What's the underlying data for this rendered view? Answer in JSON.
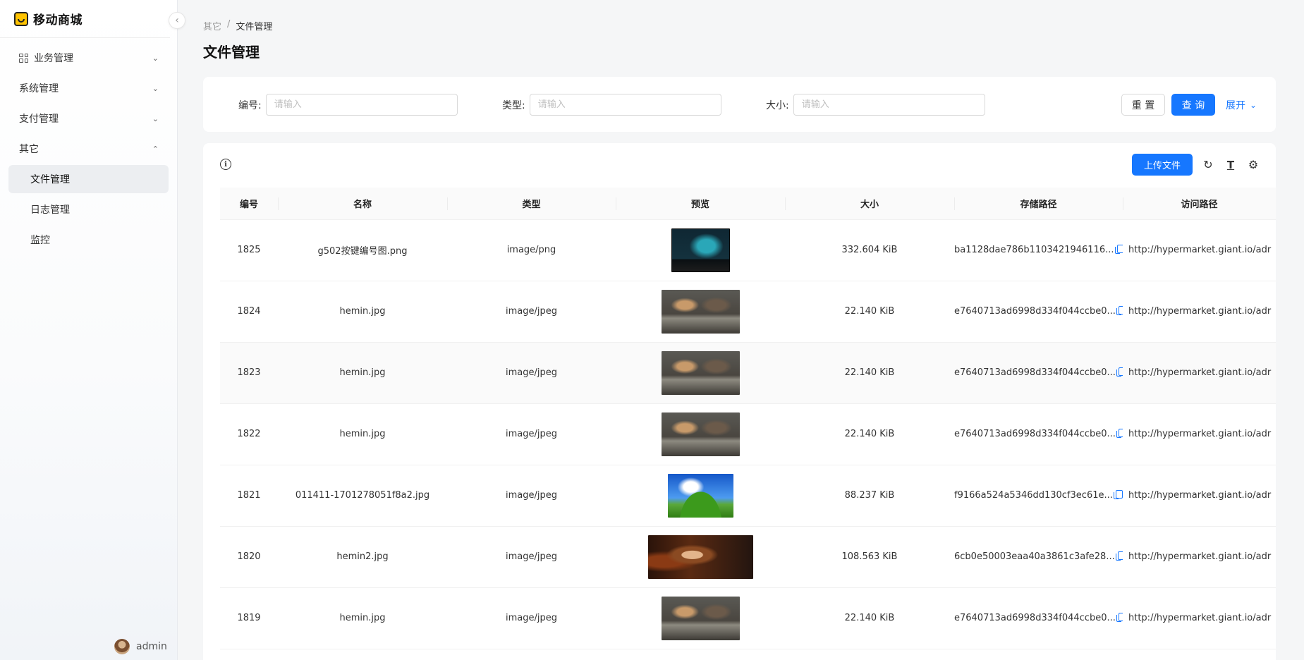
{
  "app": {
    "title": "移动商城"
  },
  "sidebar": {
    "items": [
      {
        "label": "业务管理",
        "expanded": false
      },
      {
        "label": "系统管理",
        "expanded": false
      },
      {
        "label": "支付管理",
        "expanded": false
      },
      {
        "label": "其它",
        "expanded": true
      }
    ],
    "subitems": [
      {
        "label": "文件管理",
        "active": true
      },
      {
        "label": "日志管理",
        "active": false
      },
      {
        "label": "监控",
        "active": false
      }
    ],
    "user": {
      "name": "admin"
    }
  },
  "breadcrumb": {
    "parent": "其它",
    "separator": "/",
    "current": "文件管理"
  },
  "page": {
    "title": "文件管理"
  },
  "search": {
    "fields": [
      {
        "label": "编号:",
        "placeholder": "请输入"
      },
      {
        "label": "类型:",
        "placeholder": "请输入"
      },
      {
        "label": "大小:",
        "placeholder": "请输入"
      }
    ],
    "reset_label": "重 置",
    "query_label": "查 询",
    "expand_label": "展开"
  },
  "toolbar": {
    "upload_label": "上传文件"
  },
  "table": {
    "columns": [
      "编号",
      "名称",
      "类型",
      "预览",
      "大小",
      "存储路径",
      "访问路径"
    ],
    "rows": [
      {
        "id": "1825",
        "name": "g502按键编号图.png",
        "type": "image/png",
        "preview": "g502",
        "size": "332.604 KiB",
        "storage": "ba1128dae786b1103421946116...",
        "access": "http://hypermarket.giant.io/adr"
      },
      {
        "id": "1824",
        "name": "hemin.jpg",
        "type": "image/jpeg",
        "preview": "hemin",
        "size": "22.140 KiB",
        "storage": "e7640713ad6998d334f044ccbe0...",
        "access": "http://hypermarket.giant.io/adr"
      },
      {
        "id": "1823",
        "name": "hemin.jpg",
        "type": "image/jpeg",
        "preview": "hemin",
        "size": "22.140 KiB",
        "storage": "e7640713ad6998d334f044ccbe0...",
        "access": "http://hypermarket.giant.io/adr"
      },
      {
        "id": "1822",
        "name": "hemin.jpg",
        "type": "image/jpeg",
        "preview": "hemin",
        "size": "22.140 KiB",
        "storage": "e7640713ad6998d334f044ccbe0...",
        "access": "http://hypermarket.giant.io/adr"
      },
      {
        "id": "1821",
        "name": "011411-1701278051f8a2.jpg",
        "type": "image/jpeg",
        "preview": "xp",
        "size": "88.237 KiB",
        "storage": "f9166a524a5346dd130cf3ec61e...",
        "access": "http://hypermarket.giant.io/adr"
      },
      {
        "id": "1820",
        "name": "hemin2.jpg",
        "type": "image/jpeg",
        "preview": "hemin2",
        "size": "108.563 KiB",
        "storage": "6cb0e50003eaa40a3861c3afe28...",
        "access": "http://hypermarket.giant.io/adr"
      },
      {
        "id": "1819",
        "name": "hemin.jpg",
        "type": "image/jpeg",
        "preview": "hemin",
        "size": "22.140 KiB",
        "storage": "e7640713ad6998d334f044ccbe0...",
        "access": "http://hypermarket.giant.io/adr"
      }
    ]
  },
  "colors": {
    "primary": "#1677ff",
    "brand": "#ffc300"
  },
  "icons": [
    "app-logo-icon",
    "collapse-icon",
    "grid-icon",
    "chevron-down-icon",
    "chevron-up-icon",
    "info-icon",
    "reload-icon",
    "column-height-icon",
    "setting-icon",
    "copy-icon"
  ]
}
